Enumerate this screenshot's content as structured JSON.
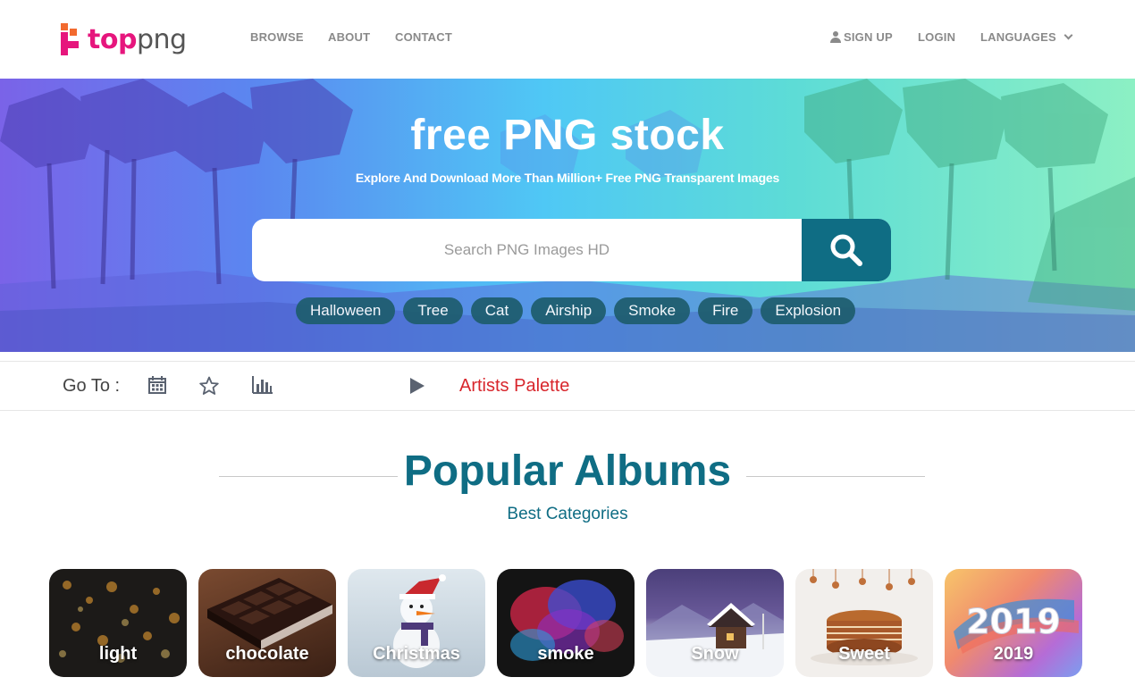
{
  "brand": {
    "logo_top": "top",
    "logo_png": "png",
    "primary_color": "#e6167d",
    "accent_color": "#0f6d84"
  },
  "nav": {
    "browse": "BROWSE",
    "about": "ABOUT",
    "contact": "CONTACT",
    "signup": "SIGN UP",
    "login": "LOGIN",
    "languages": "LANGUAGES"
  },
  "hero": {
    "title": "free PNG stock",
    "subtitle": "Explore And Download More Than Million+ Free PNG Transparent Images",
    "search_placeholder": "Search PNG Images HD",
    "search_value": "",
    "tags": [
      "Halloween",
      "Tree",
      "Cat",
      "Airship",
      "Smoke",
      "Fire",
      "Explosion"
    ]
  },
  "goto": {
    "label": "Go To :",
    "icons": [
      "calendar-icon",
      "star-icon",
      "bar-chart-icon",
      "play-icon"
    ],
    "link": "Artists Palette"
  },
  "albums": {
    "title": "Popular Albums",
    "subtitle": "Best Categories",
    "cards": [
      {
        "label": "light"
      },
      {
        "label": "chocolate"
      },
      {
        "label": "Christmas"
      },
      {
        "label": "smoke"
      },
      {
        "label": "Snow"
      },
      {
        "label": "Sweet"
      },
      {
        "label": "2019",
        "art_text": "2019"
      }
    ]
  }
}
